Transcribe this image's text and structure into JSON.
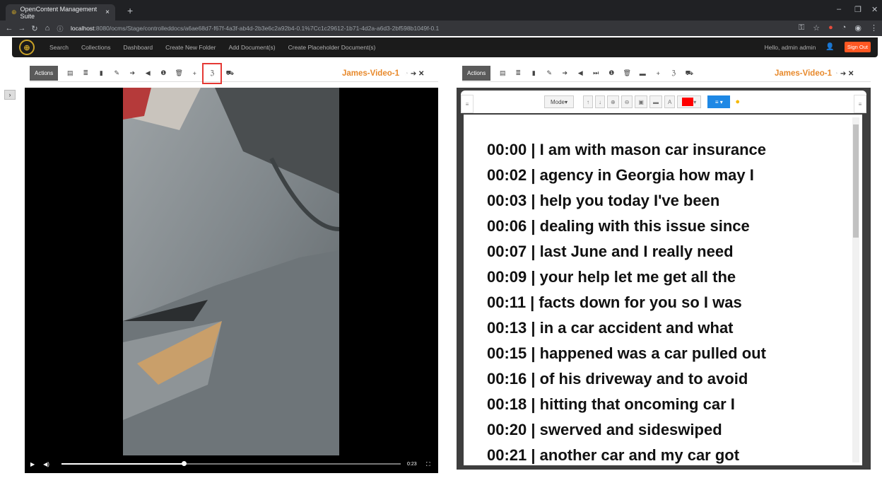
{
  "browser": {
    "tab_title": "OpenContent Management Suite",
    "tab_close": "×",
    "new_tab": "+",
    "url_host": "localhost",
    "url_path": ":8080/ocms/Stage/controlleddocs/a6ae68d7-f67f-4a3f-ab4d-2b3e6c2a92b4-0.1%7Cc1c29612-1b71-4d2a-a6d3-2bf598b1049f-0.1"
  },
  "nav": {
    "items": [
      "Search",
      "Collections",
      "Dashboard",
      "Create New Folder",
      "Add Document(s)",
      "Create Placeholder Document(s)"
    ],
    "greeting": "Hello, admin admin",
    "sign_out": "Sign Out"
  },
  "left_panel": {
    "actions_label": "Actions",
    "doc_title": "James-Video-1",
    "video_time": "0:23",
    "progress": 0.36
  },
  "right_panel": {
    "actions_label": "Actions",
    "doc_title": "James-Video-1",
    "mode_label": "Mode",
    "annotation_color": "#ff0000",
    "transcript": [
      "00:00 | I am with mason car insurance",
      "00:02 | agency in Georgia how may I",
      "00:03 | help you today I've been",
      "00:06 | dealing with this issue since",
      "00:07 | last June and I really need",
      "00:09 | your help let me get all the",
      "00:11 | facts down for you so I was",
      "00:13 | in a car accident and what",
      "00:15 | happened was a car pulled out",
      "00:16 | of his driveway and to avoid",
      "00:18 | hitting that oncoming car I",
      "00:20 | swerved and sideswiped",
      "00:21 | another car and my car got"
    ]
  },
  "colors": {
    "accent": "#e8892b",
    "signout": "#ff5722",
    "highlight_box": "#e53935"
  }
}
